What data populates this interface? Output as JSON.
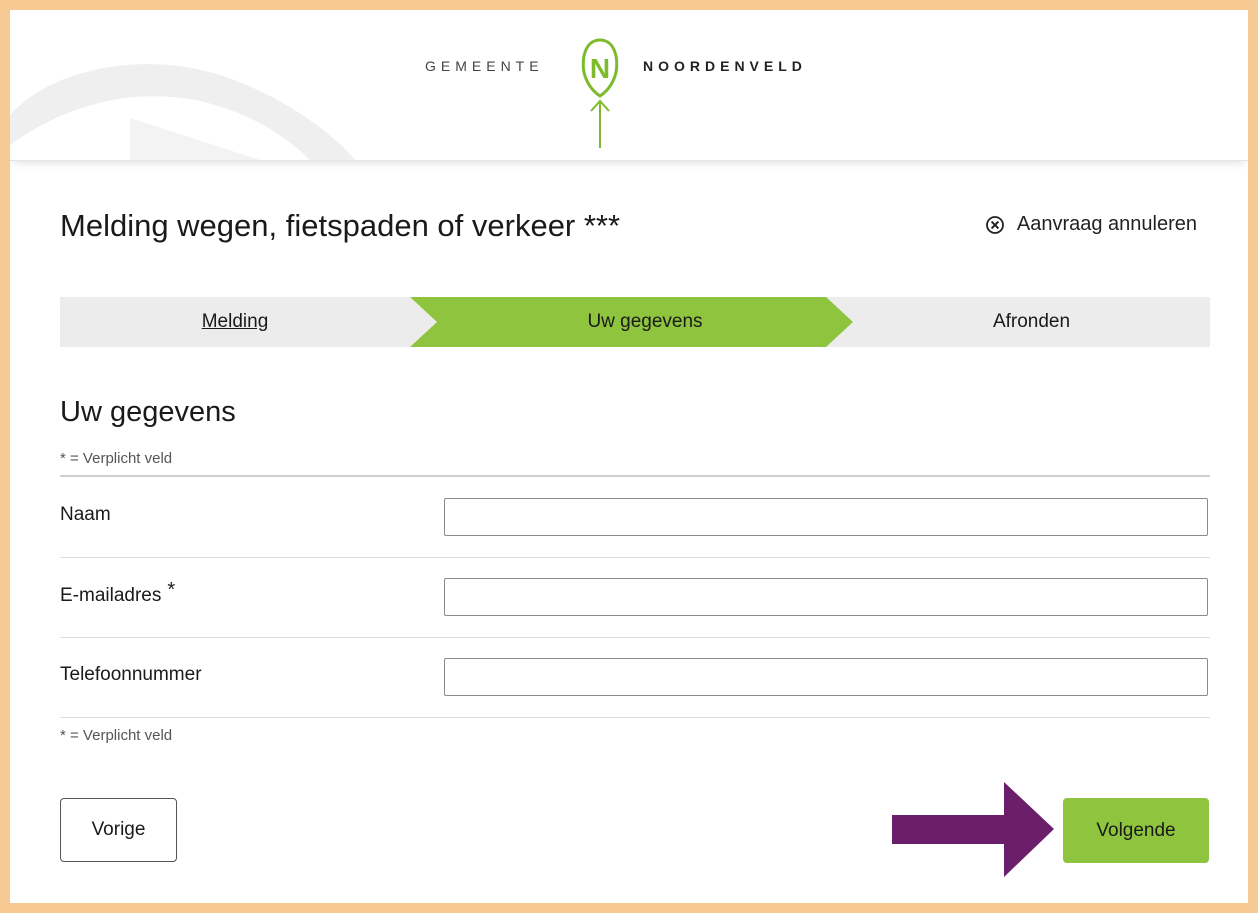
{
  "header": {
    "brand_prefix": "GEMEENTE",
    "brand_name": "NOORDENVELD",
    "logo_letter": "N",
    "logo": "noordenveld-logo",
    "decoration_icon": "header-swoosh-decoration",
    "annotation_icon": "green-up-arrow"
  },
  "page": {
    "title": "Melding wegen, fietspaden of verkeer ***",
    "cancel_label": "Aanvraag annuleren",
    "cancel_icon": "close-circle-icon"
  },
  "steps": [
    {
      "label": "Melding",
      "state": "completed"
    },
    {
      "label": "Uw gegevens",
      "state": "active"
    },
    {
      "label": "Afronden",
      "state": "upcoming"
    }
  ],
  "form": {
    "section_title": "Uw gegevens",
    "required_hint": "* = Verplicht veld",
    "fields": [
      {
        "label": "Naam",
        "required": false,
        "value": ""
      },
      {
        "label": "E-mailadres",
        "required": true,
        "required_mark": "*",
        "value": ""
      },
      {
        "label": "Telefoonnummer",
        "required": false,
        "value": ""
      }
    ]
  },
  "buttons": {
    "previous": "Vorige",
    "next": "Volgende"
  },
  "annotation": {
    "icon": "purple-right-arrow",
    "color": "#6b1f6b"
  },
  "colors": {
    "accent_green": "#8fc53e",
    "step_inactive": "#ececec",
    "frame_border": "#f7c993",
    "logo_green": "#7dbb2c"
  }
}
